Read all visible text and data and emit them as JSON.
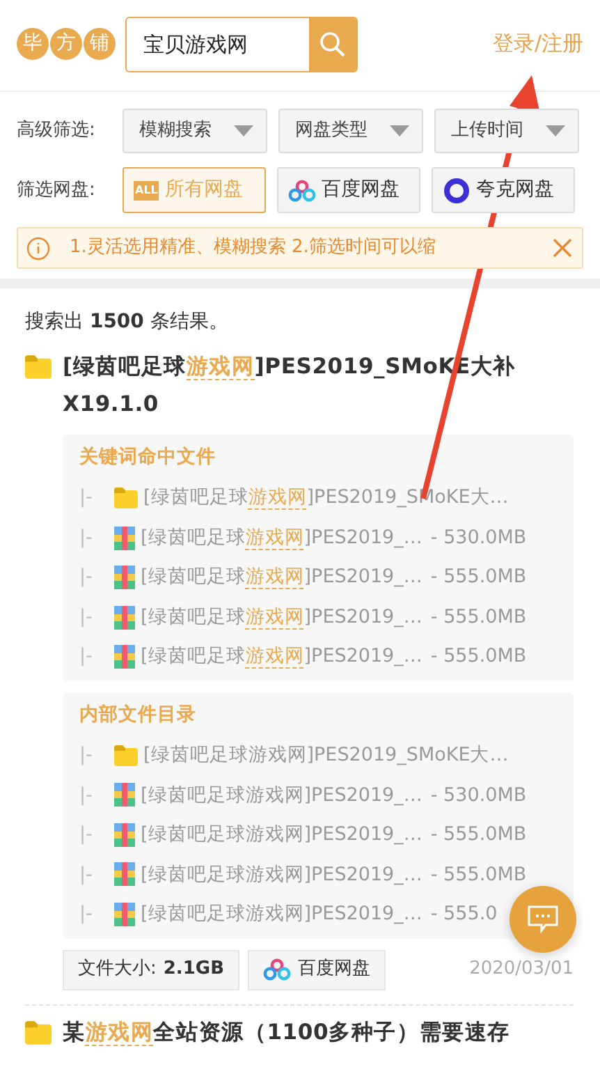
{
  "header": {
    "logo": [
      "毕",
      "方",
      "铺"
    ],
    "search": {
      "value": "宝贝游戏网"
    },
    "login": "登录/注册"
  },
  "filters": {
    "advanced_label": "高级筛选:",
    "dropdowns": [
      "模糊搜索",
      "网盘类型",
      "上传时间"
    ],
    "disk_label": "筛选网盘:",
    "disks": [
      {
        "kind": "all",
        "badge": "ALL",
        "label": "所有网盘",
        "selected": true
      },
      {
        "kind": "baidu",
        "label": "百度网盘",
        "selected": false
      },
      {
        "kind": "quark",
        "label": "夸克网盘",
        "selected": false
      }
    ],
    "notice": "1.灵活选用精准、模糊搜索 2.筛选时间可以缩"
  },
  "summary": "搜索出 **1500** 条结果。",
  "results": [
    {
      "title": [
        {
          "text": "[绿茵吧足球",
          "highlight": false
        },
        {
          "text": "游戏网",
          "highlight": true
        },
        {
          "text": "]PES2019_SMoKE大补X19.1.0",
          "highlight": false
        }
      ],
      "sections": [
        {
          "heading": "关键词命中文件",
          "files": [
            {
              "kind": "folder",
              "marker": "|-",
              "name": [
                {
                  "text": "[绿茵吧足球",
                  "highlight": false
                },
                {
                  "text": "游戏网",
                  "highlight": true
                },
                {
                  "text": "]PES2019_SMoKE大…",
                  "highlight": false
                }
              ]
            },
            {
              "kind": "archive",
              "marker": "|-",
              "name": [
                {
                  "text": "[绿茵吧足球",
                  "highlight": false
                },
                {
                  "text": "游戏网",
                  "highlight": true
                },
                {
                  "text": "]PES2019_…",
                  "highlight": false
                }
              ],
              "size": "- 530.0MB"
            },
            {
              "kind": "archive",
              "marker": "|-",
              "name": [
                {
                  "text": "[绿茵吧足球",
                  "highlight": false
                },
                {
                  "text": "游戏网",
                  "highlight": true
                },
                {
                  "text": "]PES2019_…",
                  "highlight": false
                }
              ],
              "size": "- 555.0MB"
            },
            {
              "kind": "archive",
              "marker": "|-",
              "name": [
                {
                  "text": "[绿茵吧足球",
                  "highlight": false
                },
                {
                  "text": "游戏网",
                  "highlight": true
                },
                {
                  "text": "]PES2019_…",
                  "highlight": false
                }
              ],
              "size": "- 555.0MB"
            },
            {
              "kind": "archive",
              "marker": "|-",
              "name": [
                {
                  "text": "[绿茵吧足球",
                  "highlight": false
                },
                {
                  "text": "游戏网",
                  "highlight": true
                },
                {
                  "text": "]PES2019_…",
                  "highlight": false
                }
              ],
              "size": "- 555.0MB"
            }
          ]
        },
        {
          "heading": "内部文件目录",
          "files": [
            {
              "kind": "folder",
              "marker": "|-",
              "name": [
                {
                  "text": "[绿茵吧足球游戏网]PES2019_SMoKE大…",
                  "highlight": false
                }
              ]
            },
            {
              "kind": "archive",
              "marker": "|-",
              "name": [
                {
                  "text": "[绿茵吧足球游戏网]PES2019_…",
                  "highlight": false
                }
              ],
              "size": "- 530.0MB"
            },
            {
              "kind": "archive",
              "marker": "|-",
              "name": [
                {
                  "text": "[绿茵吧足球游戏网]PES2019_…",
                  "highlight": false
                }
              ],
              "size": "- 555.0MB"
            },
            {
              "kind": "archive",
              "marker": "|-",
              "name": [
                {
                  "text": "[绿茵吧足球游戏网]PES2019_…",
                  "highlight": false
                }
              ],
              "size": "- 555.0MB"
            },
            {
              "kind": "archive",
              "marker": "|-",
              "name": [
                {
                  "text": "[绿茵吧足球游戏网]PES2019_…",
                  "highlight": false
                }
              ],
              "size": "- 555.0"
            }
          ]
        }
      ],
      "size": "文件大小:**2.1GB**",
      "disk": {
        "kind": "baidu",
        "label": "百度网盘"
      },
      "date": "2020/03/01"
    },
    {
      "title": [
        {
          "text": "某",
          "highlight": false
        },
        {
          "text": "游戏网",
          "highlight": true
        },
        {
          "text": "全站资源（1100多种子）需要速存",
          "highlight": false
        }
      ]
    }
  ]
}
